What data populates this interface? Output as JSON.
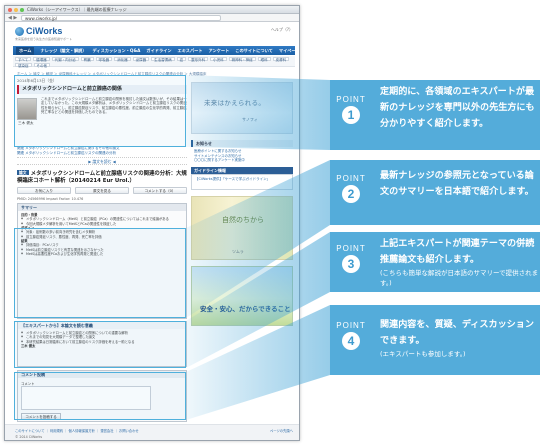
{
  "browser": {
    "title": "CiWorks（シーアイワークス）｜最先端の医療ナレッジ",
    "url": "www.ciworks.jp/"
  },
  "site": {
    "logo_text": "CiWorks",
    "tagline": "未来医療を担う先生方の医療知識サポート",
    "help_link": "ヘルプ（?）"
  },
  "gnav": [
    "ホーム",
    "ナレッジ（論文・解説）",
    "ディスカッション・Q&A",
    "ガイドライン",
    "エキスパート",
    "アンケート",
    "このサイトについて",
    "マイページ"
  ],
  "subnav": [
    "すべて",
    "循環器",
    "代謝・内分泌",
    "腎臓",
    "呼吸器",
    "消化器",
    "泌尿器",
    "生活習慣病",
    "癌",
    "整形外科",
    "小児科",
    "精神科・神経",
    "眼科",
    "皮膚科",
    "感染症",
    "その他"
  ],
  "breadcrumb": "ホーム ＞ 論文 ＞ 解説 ＞ 泌尿器科ナレッジ ＞ メタボリックシンドロームと前立腺癌リスクの関連の分析 ＞ 大規模臨床",
  "intro": {
    "date": "2014年6月13日（金）",
    "title": "メタボリックシンドロームと前立腺癌の関係",
    "expert_name": "三木 健太",
    "body": "これまでメタボリックシンドロームと前立腺癌の関係を検討した論文は数多いが、その結果は一定していなかった。この大規模メタ解析は、メタボリックシンドロームと前立腺癌リスクの関連性を明らかにし、前立腺癌発症リスク、前立腺癌の悪性度、前立腺癌の生化学的再発、前立腺癌死亡率などとの関連を評価したものである。"
  },
  "related": [
    "関連 メタボリックシンドロームと前立腺癌に関するその他の論文",
    "関連 メタボリックシンドロームと前立腺癌リスクの関連の分析"
  ],
  "ad_strip": "▶ 論文を読む ◀",
  "article": {
    "category": "論文",
    "title": "メタボリックシンドロームと前立腺癌リスクの関連の分析：大規模臨床コホート解析（20140214 Eur Urol.）",
    "buttons": [
      "お気に入り",
      "原文を見る",
      "コメントする（0）"
    ],
    "meta": "PMID: 24566996   Impact Factor: 10.476"
  },
  "summary": {
    "header": "サマリー",
    "background_label": "目的・背景",
    "background": [
      "メタボリックシンドローム（MetS）と前立腺癌（PCa）の関連性についてはこれまで議論がある",
      "今回大規模メタ解析を用いてMetSとPCaの関連性を検証した"
    ],
    "design_label": "デザイン",
    "design": [
      "対象：症例数の多い前向き研究を含むメタ解析",
      "前立腺癌発症リスク、悪性度、再発、死亡率を評価"
    ],
    "result_label": "結果",
    "result": [
      "評価項目：PCaリスク",
      "MetSは前立腺癌リスクと有意な関連を示さなかった",
      "MetSは高悪性度PCaおよび生化学的再発と関連した"
    ]
  },
  "expert": {
    "header": "【エキスパートから】本論文を読む意義",
    "items": [
      "メタボリックシンドロームと前立腺癌との関係についての重要な解析",
      "これまでの知見を大規模データで整理した論文",
      "本研究結果は日常臨床において前立腺癌のリスク評価を考える一助となる"
    ],
    "note": "三木 健太"
  },
  "comment": {
    "header": "コメント投稿",
    "label": "コメント",
    "submit": "コメントを投稿する"
  },
  "side": {
    "ad1_title": "未来はかえられる。",
    "ad1_brand": "サノフィ",
    "news_header": "お知らせ",
    "news": [
      "医療ポイントに関するお知らせ",
      "サイトメンテナンスのお知らせ",
      "〇〇〇に関するアンケート実施中"
    ],
    "guide_header": "ガイドライン情報",
    "guide_box": "【CiWorks提供】「ケースで学ぶガイドライン」",
    "ad2_title": "自然のちから",
    "ad2_brand": "ツムラ",
    "ad3_title": "安全・安心、だからできること"
  },
  "footer": {
    "links": "このサイトについて ｜ 利用規約 ｜ 個人情報保護方針 ｜ 運営会社 ｜ お問い合わせ",
    "copy": "© 2014 CiWorks",
    "pagetop": "ページの先頭へ"
  },
  "points": [
    {
      "label": "POINT",
      "num": "1",
      "text": "定期的に、各領域のエキスパートが最新のナレッジを専門以外の先生方にも分かりやすく紹介します。",
      "note": ""
    },
    {
      "label": "POINT",
      "num": "2",
      "text": "最新ナレッジの参照元となっている論文のサマリーを日本語で紹介します。",
      "note": ""
    },
    {
      "label": "POINT",
      "num": "3",
      "text": "上記エキスパートが関連テーマの併読推薦論文も紹介します。",
      "note": "(こちらも簡単な解説が日本語のサマリーで提供されます。)"
    },
    {
      "label": "POINT",
      "num": "4",
      "text": "関連内容を、質疑、ディスカッションできます。",
      "note": "(エキスパートも参加します。)"
    }
  ],
  "colors": {
    "accent": "#41a3d6",
    "nav": "#1a5fa4",
    "highlight": "#4fb0dc"
  }
}
